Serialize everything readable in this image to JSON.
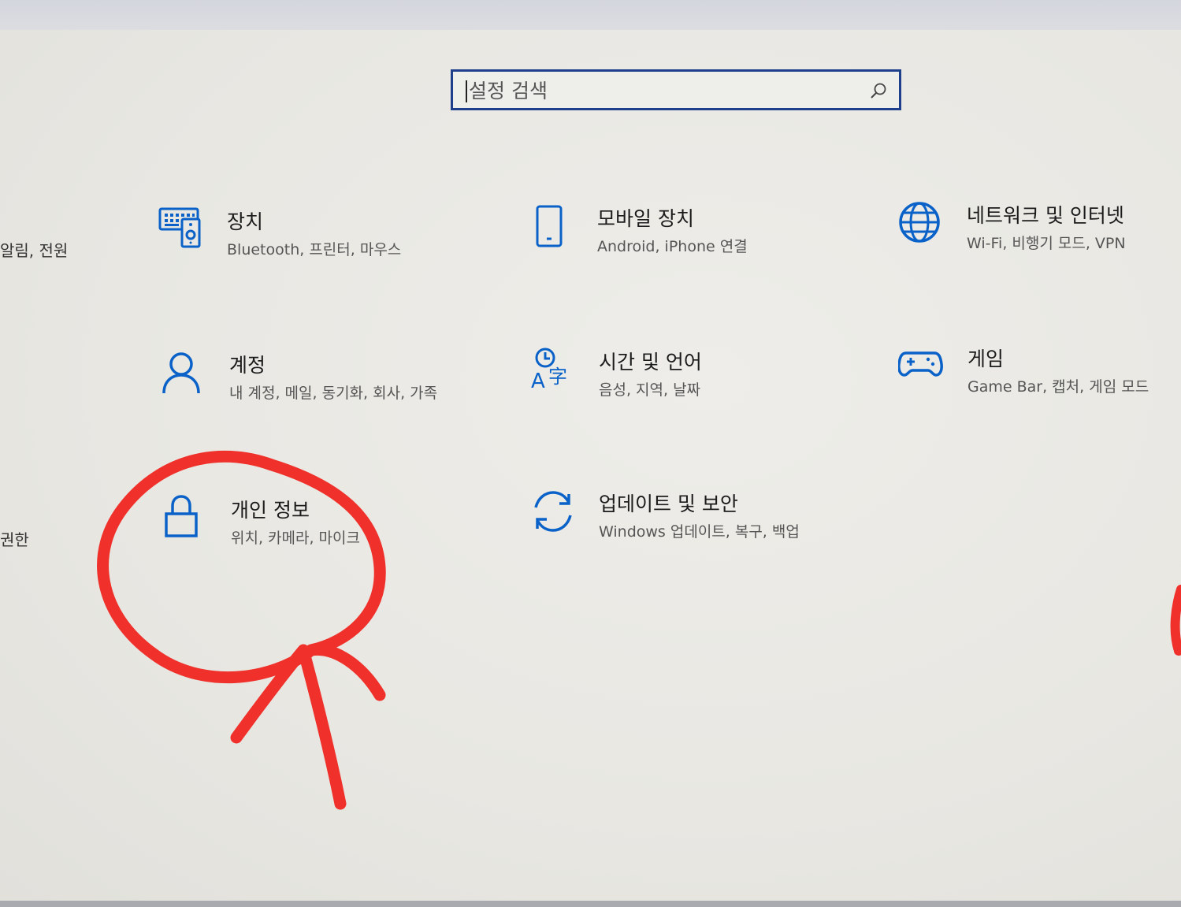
{
  "search": {
    "placeholder": "설정 검색",
    "icon": "search-icon"
  },
  "left_edge": {
    "item1_partial": "알림, 전원",
    "item2_partial": "권한"
  },
  "tiles": {
    "devices": {
      "title": "장치",
      "desc": "Bluetooth, 프린터, 마우스",
      "icon": "keyboard-speaker-icon"
    },
    "mobile": {
      "title": "모바일 장치",
      "desc": "Android, iPhone 연결",
      "icon": "phone-icon"
    },
    "network": {
      "title": "네트워크 및 인터넷",
      "desc": "Wi-Fi, 비행기 모드, VPN",
      "icon": "globe-icon"
    },
    "accounts": {
      "title": "계정",
      "desc": "내 계정, 메일, 동기화, 회사, 가족",
      "icon": "person-icon"
    },
    "time_language": {
      "title": "시간 및 언어",
      "desc": "음성, 지역, 날짜",
      "icon": "time-language-icon"
    },
    "gaming": {
      "title": "게임",
      "desc": "Game Bar, 캡처, 게임 모드",
      "icon": "gamepad-icon"
    },
    "privacy": {
      "title": "개인 정보",
      "desc": "위치, 카메라, 마이크",
      "icon": "lock-icon"
    },
    "update": {
      "title": "업데이트 및 보안",
      "desc": "Windows 업데이트, 복구, 백업",
      "icon": "sync-icon"
    }
  },
  "colors": {
    "icon_blue": "#0a62c9",
    "search_border": "#1e3f8c",
    "annotation_red": "#f0302a"
  }
}
